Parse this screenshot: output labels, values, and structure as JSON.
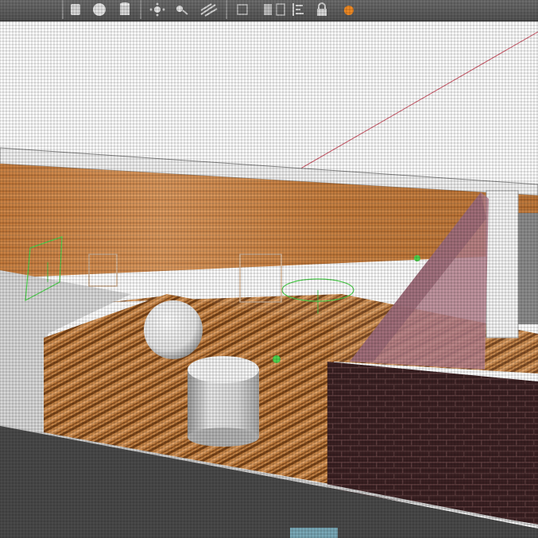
{
  "toolbar": {
    "icons": [
      "box-primitive-icon",
      "sphere-primitive-icon",
      "cylinder-primitive-icon",
      "point-light-icon",
      "spot-light-icon",
      "directional-light-icon",
      "grid-snap-icon",
      "copy-icon",
      "paste-icon",
      "align-icon",
      "lock-icon",
      "record-icon"
    ],
    "record_color": "#f08a24"
  },
  "scene": {
    "objects": [
      "white-sphere",
      "white-cylinder",
      "wooden-ground-plane",
      "wooden-back-wall",
      "brick-box",
      "translucent-ramp",
      "directional-light-gizmo",
      "spot-light-gizmo",
      "point-light-gizmo",
      "camera-gizmo"
    ],
    "colors": {
      "sky": "#ffffff",
      "wood": "#c47a3a",
      "wood_dark": "#7a4418",
      "brick": "#3b2324",
      "gizmo": "#4ed44e",
      "axis": "#d05a6a",
      "ground_gray": "#d8d8d8",
      "shadow_panel": "#4a4a4a"
    }
  }
}
